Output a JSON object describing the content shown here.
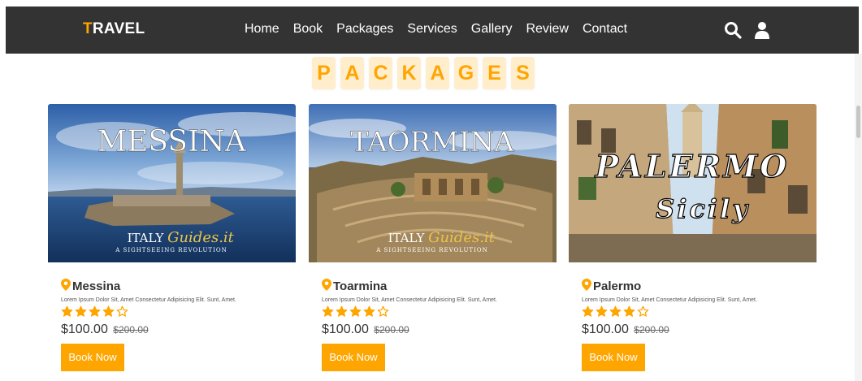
{
  "nav": {
    "logo_first": "T",
    "logo_rest": "RAVEL",
    "links": [
      "Home",
      "Book",
      "Packages",
      "Services",
      "Gallery",
      "Review",
      "Contact"
    ],
    "icons": [
      "search-icon",
      "user-icon"
    ]
  },
  "heading_letters": [
    "P",
    "A",
    "C",
    "K",
    "A",
    "G",
    "E",
    "S"
  ],
  "cards": [
    {
      "image_title": "MESSINA",
      "image_brand": "ITALY",
      "image_brand_script": "Guides.it",
      "image_tagline": "A SIGHTSEEING REVOLUTION",
      "title": "Messina",
      "description": "Lorem Ipsum Dolor Sit, Amet Consectetur Adipisicing Elit. Sunt, Amet.",
      "rating": 4,
      "max_rating": 5,
      "price": "$100.00",
      "old_price": "$200.00",
      "button": "Book Now"
    },
    {
      "image_title": "TAORMINA",
      "image_brand": "ITALY",
      "image_brand_script": "Guides.it",
      "image_tagline": "A SIGHTSEEING REVOLUTION",
      "title": "Toarmina",
      "description": "Lorem Ipsum Dolor Sit, Amet Consectetur Adipisicing Elit. Sunt, Amet.",
      "rating": 4,
      "max_rating": 5,
      "price": "$100.00",
      "old_price": "$200.00",
      "button": "Book Now"
    },
    {
      "image_title": "PALERMO",
      "image_subtitle": "Sicily",
      "title": "Palermo",
      "description": "Lorem Ipsum Dolor Sit, Amet Consectetur Adipisicing Elit. Sunt, Amet.",
      "rating": 4,
      "max_rating": 5,
      "price": "$100.00",
      "old_price": "$200.00",
      "button": "Book Now"
    }
  ],
  "colors": {
    "accent": "#ffa500",
    "navbar": "#333333",
    "heading_bg": "#ffedcc"
  }
}
